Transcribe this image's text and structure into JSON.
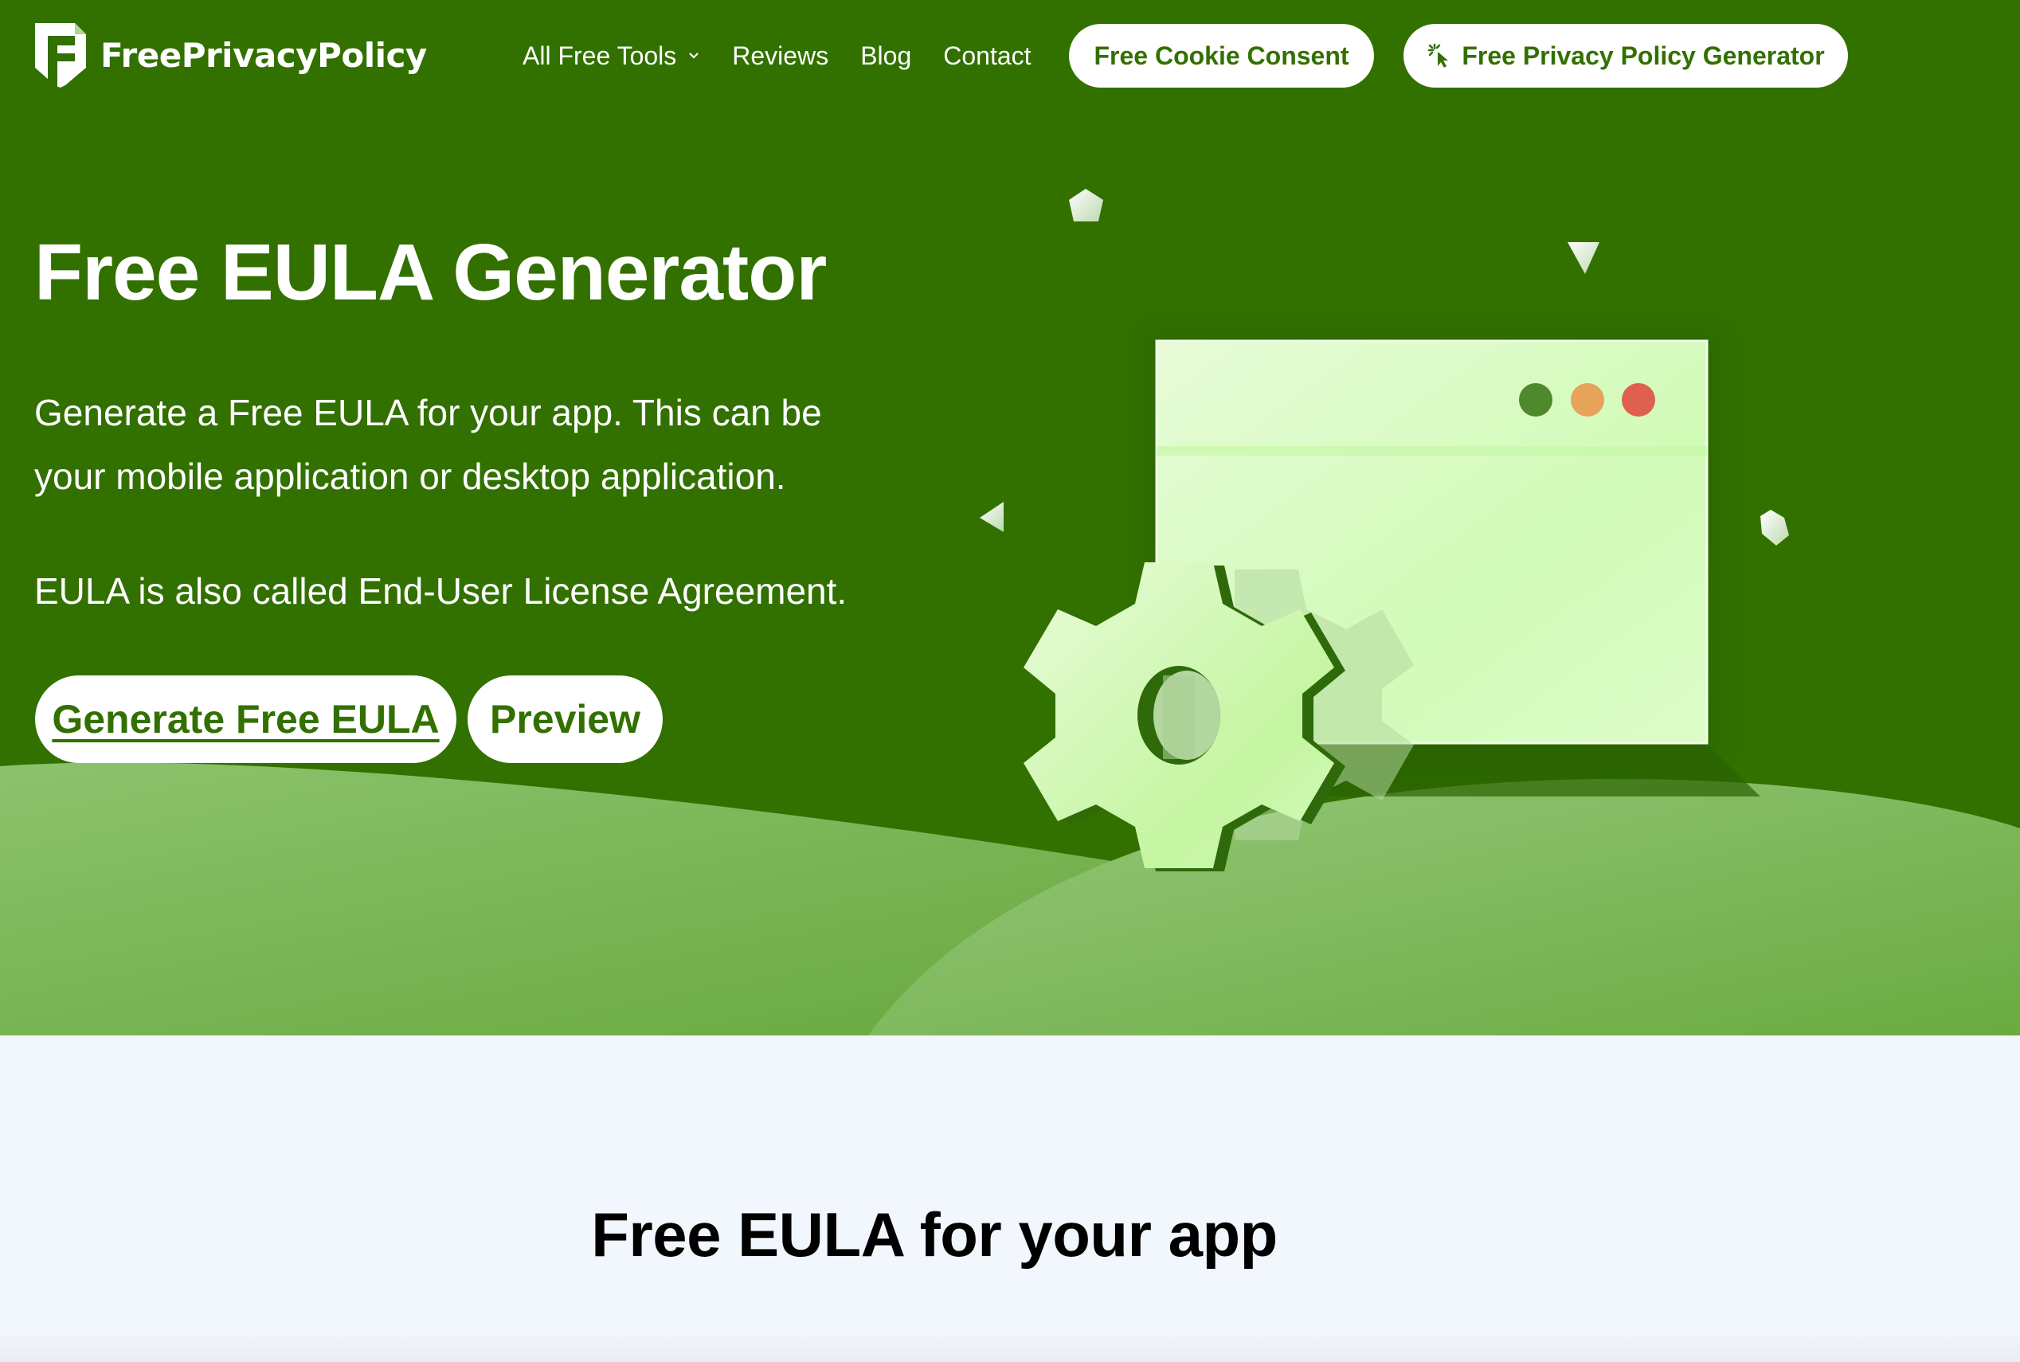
{
  "header": {
    "logo_text": "FreePrivacyPolicy",
    "logo_icon": "shield-f-icon",
    "nav": [
      {
        "label": "All Free Tools",
        "has_dropdown": true
      },
      {
        "label": "Reviews"
      },
      {
        "label": "Blog"
      },
      {
        "label": "Contact"
      }
    ],
    "cookie_button": "Free Cookie Consent",
    "ppg_button": "Free Privacy Policy Generator",
    "ppg_icon": "sparkle-cursor-icon"
  },
  "hero": {
    "title": "Free EULA Generator",
    "paragraph1": "Generate a Free EULA for your app. This can be your mobile application or desktop application.",
    "paragraph2": "EULA is also called End-User License Agreement.",
    "generate_button": "Generate Free EULA",
    "preview_button": "Preview",
    "illustration": {
      "window_dots": [
        "#4e8a2c",
        "#e6a359",
        "#e06050"
      ],
      "icon": "gear-icon"
    }
  },
  "colors": {
    "brand_green": "#327000",
    "hill_light": "#8bc06a",
    "section_bg": "#f2f6fd"
  },
  "section": {
    "title": "Free EULA for your app"
  }
}
